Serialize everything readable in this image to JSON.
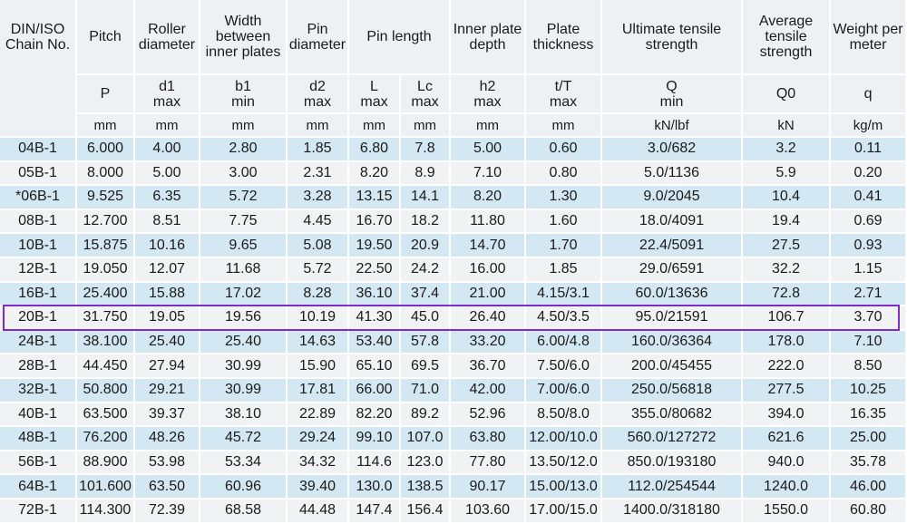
{
  "header": {
    "chain": "DIN/ISO Chain No.",
    "columns": [
      {
        "title": "Pitch",
        "sym": "P",
        "sub": "",
        "unit": "mm"
      },
      {
        "title": "Roller diameter",
        "sym": "d1",
        "sub": "max",
        "unit": "mm"
      },
      {
        "title": "Width between inner plates",
        "sym": "b1",
        "sub": "min",
        "unit": "mm"
      },
      {
        "title": "Pin diameter",
        "sym": "d2",
        "sub": "max",
        "unit": "mm"
      },
      {
        "title": "Pin length",
        "sym": "L",
        "sub": "max",
        "unit": "mm"
      },
      {
        "title": "",
        "sym": "Lc",
        "sub": "max",
        "unit": "mm"
      },
      {
        "title": "Inner plate depth",
        "sym": "h2",
        "sub": "max",
        "unit": "mm"
      },
      {
        "title": "Plate thickness",
        "sym": "t/T",
        "sub": "max",
        "unit": "mm"
      },
      {
        "title": "Ultimate tensile strength",
        "sym": "Q",
        "sub": "min",
        "unit": "kN/lbf"
      },
      {
        "title": "Average tensile strength",
        "sym": "Q0",
        "sub": "",
        "unit": "kN"
      },
      {
        "title": "Weight per meter",
        "sym": "q",
        "sub": "",
        "unit": "kg/m"
      }
    ]
  },
  "rows": [
    [
      "04B-1",
      "6.000",
      "4.00",
      "2.80",
      "1.85",
      "6.80",
      "7.8",
      "5.00",
      "0.60",
      "3.0/682",
      "3.2",
      "0.11"
    ],
    [
      "05B-1",
      "8.000",
      "5.00",
      "3.00",
      "2.31",
      "8.20",
      "8.9",
      "7.10",
      "0.80",
      "5.0/1136",
      "5.9",
      "0.20"
    ],
    [
      "*06B-1",
      "9.525",
      "6.35",
      "5.72",
      "3.28",
      "13.15",
      "14.1",
      "8.20",
      "1.30",
      "9.0/2045",
      "10.4",
      "0.41"
    ],
    [
      "08B-1",
      "12.700",
      "8.51",
      "7.75",
      "4.45",
      "16.70",
      "18.2",
      "11.80",
      "1.60",
      "18.0/4091",
      "19.4",
      "0.69"
    ],
    [
      "10B-1",
      "15.875",
      "10.16",
      "9.65",
      "5.08",
      "19.50",
      "20.9",
      "14.70",
      "1.70",
      "22.4/5091",
      "27.5",
      "0.93"
    ],
    [
      "12B-1",
      "19.050",
      "12.07",
      "11.68",
      "5.72",
      "22.50",
      "24.2",
      "16.00",
      "1.85",
      "29.0/6591",
      "32.2",
      "1.15"
    ],
    [
      "16B-1",
      "25.400",
      "15.88",
      "17.02",
      "8.28",
      "36.10",
      "37.4",
      "21.00",
      "4.15/3.1",
      "60.0/13636",
      "72.8",
      "2.71"
    ],
    [
      "20B-1",
      "31.750",
      "19.05",
      "19.56",
      "10.19",
      "41.30",
      "45.0",
      "26.40",
      "4.50/3.5",
      "95.0/21591",
      "106.7",
      "3.70"
    ],
    [
      "24B-1",
      "38.100",
      "25.40",
      "25.40",
      "14.63",
      "53.40",
      "57.8",
      "33.20",
      "6.00/4.8",
      "160.0/36364",
      "178.0",
      "7.10"
    ],
    [
      "28B-1",
      "44.450",
      "27.94",
      "30.99",
      "15.90",
      "65.10",
      "69.5",
      "36.70",
      "7.50/6.0",
      "200.0/45455",
      "222.0",
      "8.50"
    ],
    [
      "32B-1",
      "50.800",
      "29.21",
      "30.99",
      "17.81",
      "66.00",
      "71.0",
      "42.00",
      "7.00/6.0",
      "250.0/56818",
      "277.5",
      "10.25"
    ],
    [
      "40B-1",
      "63.500",
      "39.37",
      "38.10",
      "22.89",
      "82.20",
      "89.2",
      "52.96",
      "8.50/8.0",
      "355.0/80682",
      "394.0",
      "16.35"
    ],
    [
      "48B-1",
      "76.200",
      "48.26",
      "45.72",
      "29.24",
      "99.10",
      "107.0",
      "63.80",
      "12.00/10.0",
      "560.0/127272",
      "621.6",
      "25.00"
    ],
    [
      "56B-1",
      "88.900",
      "53.98",
      "53.34",
      "34.32",
      "114.6",
      "123.0",
      "77.80",
      "13.50/12.0",
      "850.0/193180",
      "940.0",
      "35.78"
    ],
    [
      "64B-1",
      "101.600",
      "63.50",
      "60.96",
      "39.40",
      "130.0",
      "138.5",
      "90.17",
      "15.00/13.0",
      "112.0/254544",
      "1240.0",
      "46.00"
    ],
    [
      "72B-1",
      "114.300",
      "72.39",
      "68.58",
      "44.48",
      "147.4",
      "156.4",
      "103.60",
      "17.00/15.0",
      "1400.0/318180",
      "1550.0",
      "60.80"
    ]
  ],
  "highlighted_row": "20B-1",
  "colors": {
    "header_bg": "#eef1f3",
    "row_blue": "#d4e8f4",
    "row_gray": "#f1f2f3",
    "highlight": "#7b2cc9"
  }
}
